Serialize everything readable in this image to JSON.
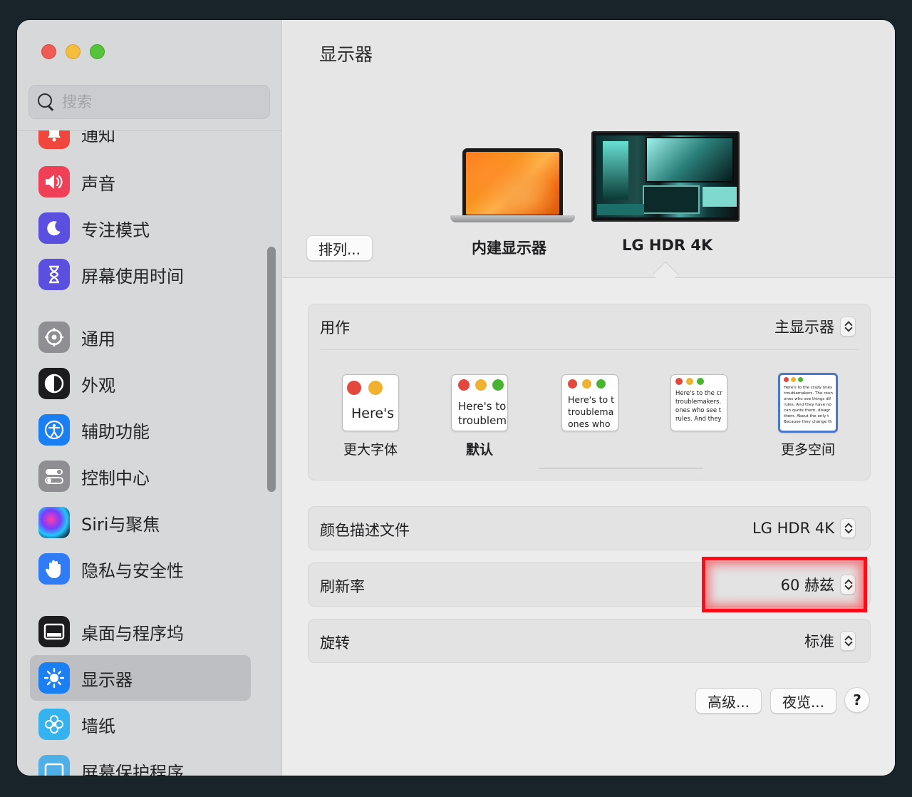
{
  "sidebar": {
    "search_placeholder": "搜索",
    "items": [
      {
        "label": "通知",
        "icon": "bell-icon",
        "color": "#f0463c"
      },
      {
        "label": "声音",
        "icon": "speaker-icon",
        "color": "#ef4057"
      },
      {
        "label": "专注模式",
        "icon": "moon-icon",
        "color": "#5b4fe0"
      },
      {
        "label": "屏幕使用时间",
        "icon": "hourglass-icon",
        "color": "#5b4fe0"
      },
      {
        "label": "通用",
        "icon": "gear-icon",
        "color": "#8e8e93"
      },
      {
        "label": "外观",
        "icon": "appearance-icon",
        "color": "#1c1c1e"
      },
      {
        "label": "辅助功能",
        "icon": "accessibility-icon",
        "color": "#1a7ff2"
      },
      {
        "label": "控制中心",
        "icon": "control-center-icon",
        "color": "#8e8e93"
      },
      {
        "label": "Siri与聚焦",
        "icon": "siri-icon",
        "color": "#2b2b3a"
      },
      {
        "label": "隐私与安全性",
        "icon": "hand-icon",
        "color": "#2f7cf6"
      },
      {
        "label": "桌面与程序坞",
        "icon": "dock-icon",
        "color": "#1c1c1e"
      },
      {
        "label": "显示器",
        "icon": "brightness-icon",
        "color": "#1a7ff2"
      },
      {
        "label": "墙纸",
        "icon": "flower-icon",
        "color": "#35b3f0"
      },
      {
        "label": "屏幕保护程序",
        "icon": "screensaver-icon",
        "color": "#4fb0e8"
      }
    ]
  },
  "main": {
    "title": "显示器",
    "arrange_button": "排列...",
    "displays": [
      {
        "label": "内建显示器"
      },
      {
        "label": "LG HDR 4K",
        "selected": true
      }
    ],
    "use_as": {
      "label": "用作",
      "value": "主显示器"
    },
    "resolution_options": [
      {
        "label": "更大字体",
        "sample": "Here's"
      },
      {
        "label": "默认",
        "sample": "Here's to\ntroublem"
      },
      {
        "label": "",
        "sample": "Here's to t\ntroublema\nones who"
      },
      {
        "label": "",
        "sample": "Here's to the cr\ntroublemakers.\nones who see t\nrules. And they"
      },
      {
        "label": "更多空间",
        "sample": "Here's to the crazy ones\ntroublemakers. The roun\nones who see things dif\nrules. And they have no\ncan quote them, disagr\nthem. About the only t\nBecause they change th",
        "selected": true
      }
    ],
    "color_profile": {
      "label": "颜色描述文件",
      "value": "LG HDR 4K"
    },
    "refresh_rate": {
      "label": "刷新率",
      "value": "60 赫兹"
    },
    "rotation": {
      "label": "旋转",
      "value": "标准"
    },
    "advanced_button": "高级...",
    "night_shift_button": "夜览...",
    "help_button": "?",
    "highlight_color": "#ff0a17"
  }
}
